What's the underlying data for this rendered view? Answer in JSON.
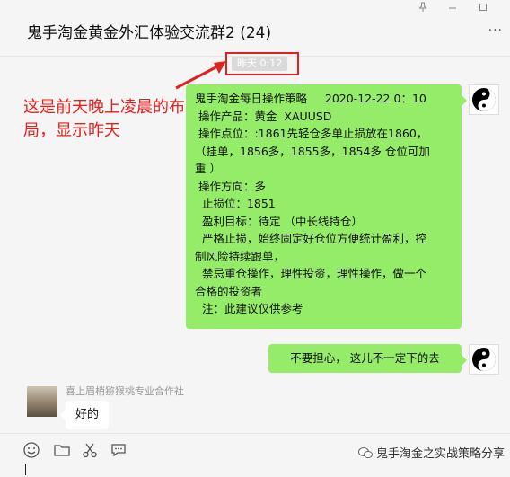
{
  "window": {
    "title": "鬼手淘金黄金外汇体验交流群2 (24)",
    "more": "···"
  },
  "chat": {
    "timestamp": "昨天 0:12",
    "annotation": "这是前天晚上凌晨的布局，显示昨天",
    "strategy_lines": [
      "鬼手淘金每日操作策略     2020-12-22 0：10",
      " 操作产品：黄金  XAUUSD",
      " 操作点位：:1861先轻仓多单止损放在1860，",
      "（挂单，1856多，1855多，1854多 仓位可加",
      "重 ）",
      " 操作方向：多",
      "  止损位：1851",
      "  盈利目标：待定 （中长线持仓）",
      "  严格止损，始终固定好仓位方便统计盈利，控",
      "制风险持续跟单，",
      "  禁忌重仓操作，理性投资，理性操作，做一个",
      "合格的投资者",
      "  注：此建议仅供参考"
    ],
    "reply_text": "不要担心， 这儿不一定下的去",
    "other_sender": "喜上眉梢猕猴桃专业合作社",
    "other_message": "好的"
  },
  "watermark": "鬼手淘金之实战策略分享",
  "colors": {
    "bubble_green": "#95ec69",
    "annotation_red": "#e0211d",
    "background": "#f5f5f5"
  }
}
